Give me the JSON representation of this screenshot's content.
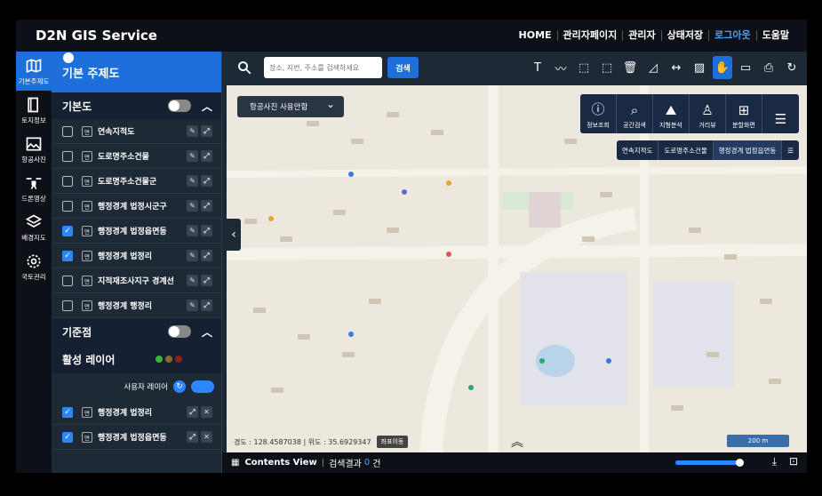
{
  "header": {
    "brand": "D2N GIS Service",
    "nav": [
      "HOME",
      "관리자페이지",
      "관리자",
      "상태저장",
      "로그아웃",
      "도움말"
    ]
  },
  "rail": [
    {
      "label": "기본주제도",
      "icon": "map-icon"
    },
    {
      "label": "토지정보",
      "icon": "book-icon"
    },
    {
      "label": "항공사진",
      "icon": "image-icon"
    },
    {
      "label": "드론영상",
      "icon": "drone-icon"
    },
    {
      "label": "배경지도",
      "icon": "layers-icon"
    },
    {
      "label": "국토관리",
      "icon": "gear-icon"
    }
  ],
  "panel": {
    "title": "기본 주제도",
    "section1": "기본도",
    "layers": [
      {
        "label": "연속지적도",
        "checked": false
      },
      {
        "label": "도로명주소건물",
        "checked": false
      },
      {
        "label": "도로명주소건물군",
        "checked": false
      },
      {
        "label": "행정경계 법정시군구",
        "checked": false
      },
      {
        "label": "행정경계 법정읍면동",
        "checked": true
      },
      {
        "label": "행정경계 법정리",
        "checked": true
      },
      {
        "label": "지적재조사지구 경계선",
        "checked": false
      },
      {
        "label": "행정경계 행정리",
        "checked": false
      }
    ],
    "tag": "면",
    "section2": "기준점",
    "active_title": "활성 레이어",
    "user_layer": "사용자 레이어",
    "active_layers": [
      {
        "label": "행정경계 법정리",
        "checked": true
      },
      {
        "label": "행정경계 법정읍면동",
        "checked": true
      }
    ]
  },
  "toolbar": {
    "search_placeholder": "장소, 지번, 주소를 검색하세요",
    "search_label": "검색"
  },
  "map": {
    "basemap": "항공사진 사용안함",
    "tools": [
      {
        "label": "정보조회",
        "icon": "info-icon"
      },
      {
        "label": "공간검색",
        "icon": "search-area-icon"
      },
      {
        "label": "지형분석",
        "icon": "terrain-icon"
      },
      {
        "label": "거리뷰",
        "icon": "streetview-icon"
      },
      {
        "label": "분할화면",
        "icon": "split-icon"
      }
    ],
    "chips": [
      "연속지적도",
      "도로명주소건물",
      "행정경계 법정읍면동"
    ],
    "coords_text": "경도 : 128.4587038 | 위도 : 35.6929347",
    "coords_button": "좌표이동",
    "scale": "200 m"
  },
  "bottom": {
    "title": "Contents View",
    "result_label": "검색결과",
    "count": "0",
    "unit": "건"
  },
  "colors": {
    "accent": "#1d6fd9",
    "dark": "#0d1117",
    "panel": "#1e2936"
  }
}
